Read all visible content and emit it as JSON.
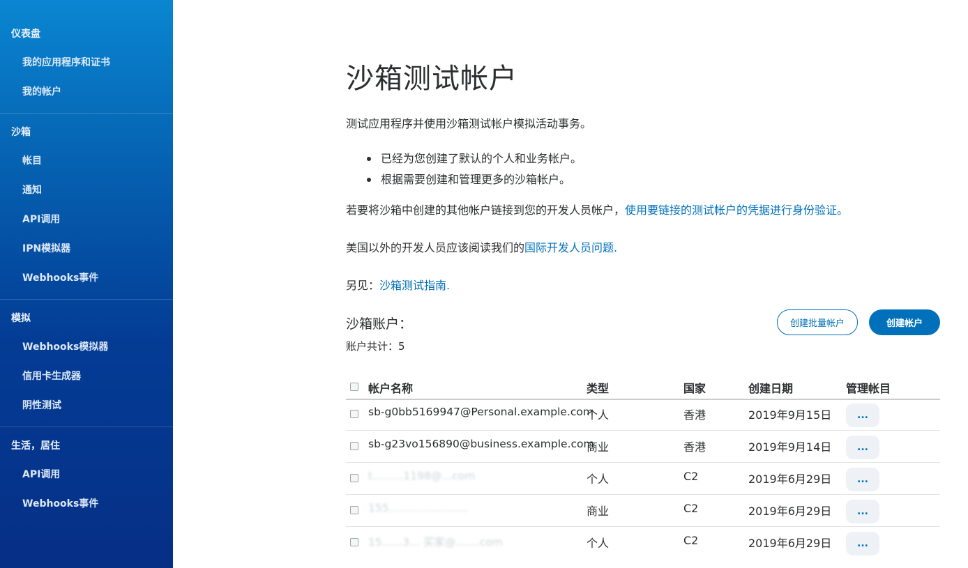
{
  "sidebar": {
    "sections": [
      {
        "heading": "仪表盘",
        "items": [
          "我的应用程序和证书",
          "我的帐户"
        ]
      },
      {
        "heading": "沙箱",
        "items": [
          "帐目",
          "通知",
          "API调用",
          "IPN模拟器",
          "Webhooks事件"
        ]
      },
      {
        "heading": "模拟",
        "items": [
          "Webhooks模拟器",
          "信用卡生成器",
          "阴性测试"
        ]
      },
      {
        "heading": "生活，居住",
        "items": [
          "API调用",
          "Webhooks事件"
        ]
      }
    ]
  },
  "main": {
    "title": "沙箱测试帐户",
    "intro": "测试应用程序并使用沙箱测试帐户模拟活动事务。",
    "bullets": [
      "已经为您创建了默认的个人和业务帐户。",
      "根据需要创建和管理更多的沙箱帐户。"
    ],
    "link_para": {
      "text": "若要将沙箱中创建的其他帐户链接到您的开发人员帐户，",
      "link": "使用要链接的测试帐户的凭据进行身份验证。"
    },
    "intl_para": {
      "text": "美国以外的开发人员应该阅读我们的",
      "link": "国际开发人员问题",
      "suffix": "."
    },
    "see_also": {
      "text": "另见：",
      "link": "沙箱测试指南",
      "suffix": "."
    },
    "accounts_title": "沙箱账户：",
    "accounts_count": "账户共计：5",
    "buttons": {
      "bulk": "创建批量帐户",
      "create": "创建帐户"
    }
  },
  "table": {
    "headers": {
      "name": "帐户名称",
      "type": "类型",
      "country": "国家",
      "date": "创建日期",
      "manage": "管理帐目"
    },
    "rows": [
      {
        "name": "sb-g0bb5169947@Personal.example.com",
        "type": "个人",
        "country": "香港",
        "date": "2019年9月15日",
        "manage": "..."
      },
      {
        "name": "sb-g23vo156890@business.example.com",
        "type": "商业",
        "country": "香港",
        "date": "2019年9月14日",
        "manage": "..."
      },
      {
        "name": "t.........1198@...com",
        "type": "个人",
        "country": "C2",
        "date": "2019年6月29日",
        "manage": "..."
      },
      {
        "name": "155.......................",
        "type": "商业",
        "country": "C2",
        "date": "2019年6月29日",
        "manage": "..."
      },
      {
        "name": "15......3... 买家@.......com",
        "type": "个人",
        "country": "C2",
        "date": "2019年6月29日",
        "manage": "..."
      }
    ]
  }
}
